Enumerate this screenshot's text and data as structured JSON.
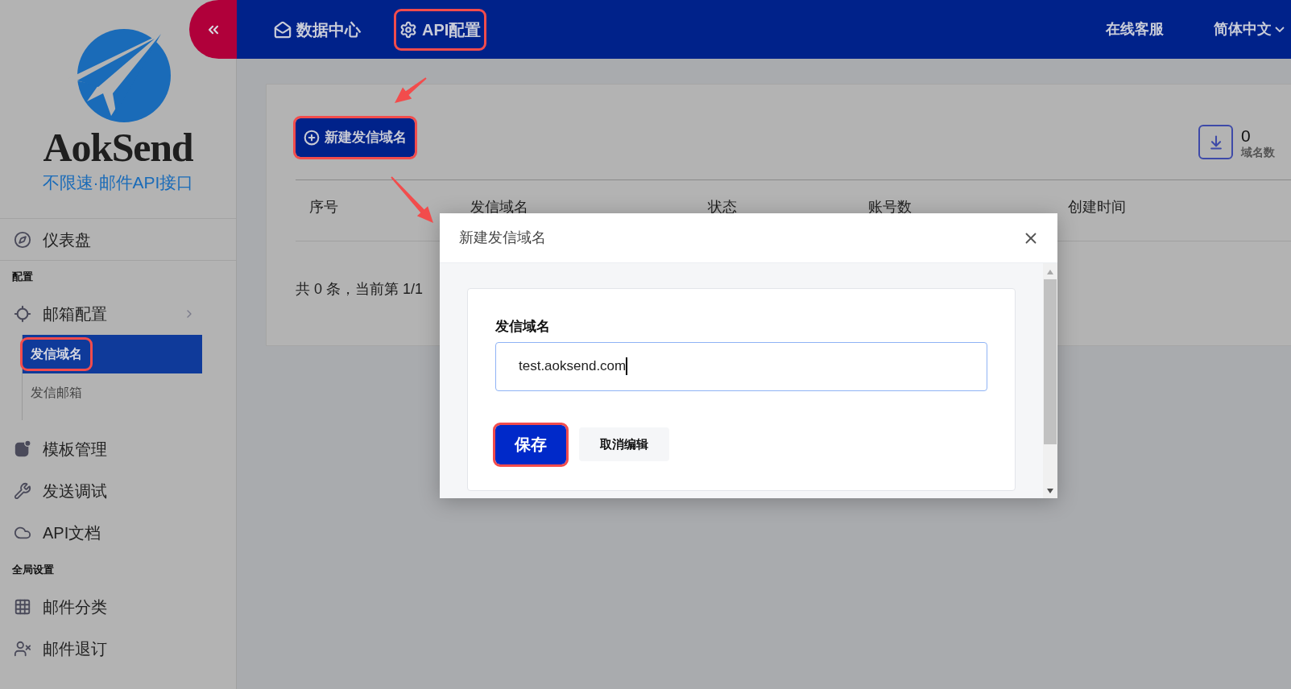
{
  "sidebar": {
    "brand": "AokSend",
    "slogan": "不限速·邮件API接口",
    "menu": [
      {
        "kind": "link",
        "label": "仪表盘"
      },
      {
        "kind": "heading",
        "label": "配置"
      },
      {
        "kind": "parent",
        "label": "邮箱配置",
        "expanded": true,
        "children": [
          {
            "label": "发信域名",
            "selected": true,
            "annotated": true
          },
          {
            "label": "发信邮箱",
            "selected": false,
            "annotated": false
          }
        ]
      },
      {
        "kind": "link",
        "label": "模板管理"
      },
      {
        "kind": "link",
        "label": "发送调试"
      },
      {
        "kind": "link",
        "label": "API文档"
      },
      {
        "kind": "heading",
        "label": "全局设置"
      },
      {
        "kind": "link",
        "label": "邮件分类"
      },
      {
        "kind": "link",
        "label": "邮件退订"
      }
    ]
  },
  "header": {
    "nav": [
      {
        "label": "数据中心",
        "annotated": false
      },
      {
        "label": "API配置",
        "annotated": true
      }
    ],
    "links": [
      "在线客服",
      "简体中文"
    ]
  },
  "content": {
    "new_button": {
      "label": "新建发信域名",
      "annotated": true
    },
    "stat": {
      "value": "0",
      "label": "域名数"
    },
    "table": {
      "columns": [
        "序号",
        "发信域名",
        "状态",
        "账号数",
        "创建时间"
      ]
    },
    "pagination": "共 0 条，当前第 1/1"
  },
  "modal": {
    "title": "新建发信域名",
    "field": {
      "label": "发信域名",
      "value": "test.aoksend.com"
    },
    "buttons": [
      {
        "kind": "primary",
        "label": "保存",
        "annotated": true
      },
      {
        "kind": "secondary",
        "label": "取消编辑",
        "annotated": false
      }
    ]
  }
}
